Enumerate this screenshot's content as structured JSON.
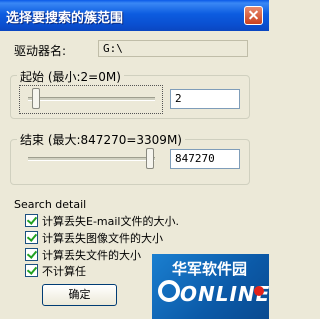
{
  "window": {
    "title": "选择要搜索的簇范围"
  },
  "drive": {
    "label": "驱动器名:",
    "value": "G:\\"
  },
  "start": {
    "label": "起始 (最小:2=0M)",
    "value": "2"
  },
  "end": {
    "label": "结束 (最大:847270=3309M)",
    "value": "847270"
  },
  "search_detail": {
    "heading": "Search detail",
    "options": [
      {
        "label": "计算丢失E-mail文件的大小.",
        "checked": true
      },
      {
        "label": "计算丢失图像文件的大小",
        "checked": true
      },
      {
        "label": "计算丢失文件的大小",
        "checked": true
      },
      {
        "label": "不计算任",
        "checked": true
      }
    ]
  },
  "buttons": {
    "ok": "确定"
  },
  "watermark": {
    "cn": "华军软件园",
    "en": "ONLINE"
  },
  "colors": {
    "titlebar": "#0a5ae8",
    "dialog": "#ece9d8",
    "watermark_bg": "#0b5aa8"
  }
}
